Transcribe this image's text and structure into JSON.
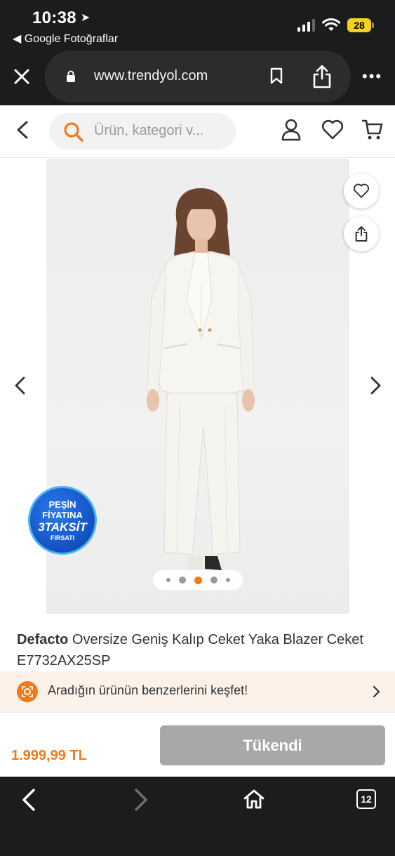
{
  "status": {
    "time": "10:38",
    "back_app": "◀ Google Fotoğraflar",
    "battery": "28"
  },
  "browser": {
    "url": "www.trendyol.com",
    "tab_count": "12"
  },
  "header": {
    "search_placeholder": "Ürün, kategori v..."
  },
  "gallery": {
    "badge": {
      "line1": "PEŞİN",
      "line2": "FİYATINA",
      "line3": "3TAKSİT",
      "line4": "FIRSATI"
    },
    "image_count": 5,
    "active_index": 2
  },
  "product": {
    "brand": "Defacto",
    "name": " Oversize Geniş Kalıp Ceket Yaka Blazer Ceket E7732AX25SP",
    "similar_text": "Aradığın ürünün benzerlerini keşfet!",
    "price": "1.999,99 TL",
    "action_label": "Tükendi"
  },
  "colors": {
    "brand_orange": "#f27a1a",
    "disabled_button": "#a8a8a8",
    "chrome_dark": "#1c1c1e"
  }
}
